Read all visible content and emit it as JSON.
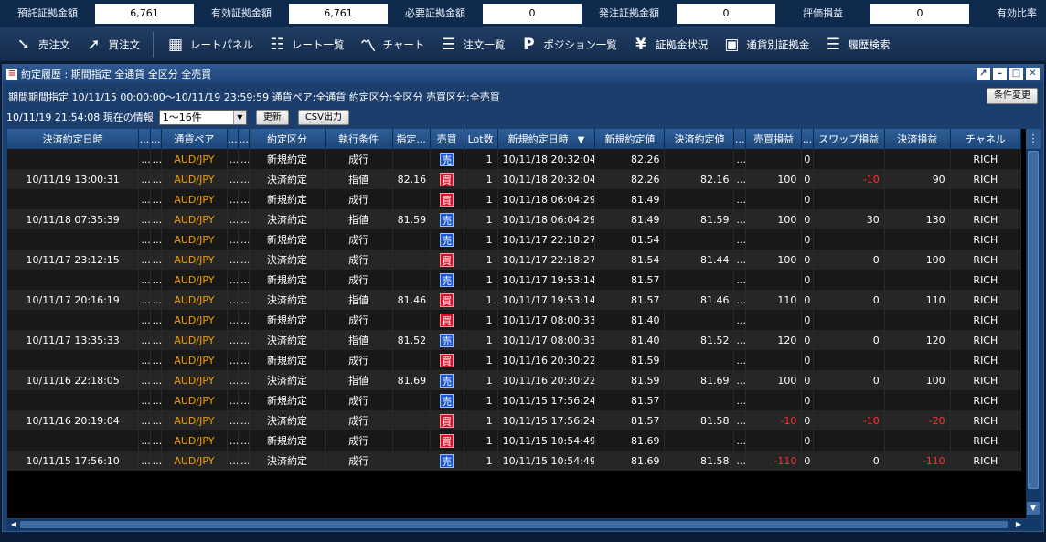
{
  "summary": [
    {
      "label": "預託証拠金額",
      "value": "6,761"
    },
    {
      "label": "有効証拠金額",
      "value": "6,761"
    },
    {
      "label": "必要証拠金額",
      "value": "0"
    },
    {
      "label": "発注証拠金額",
      "value": "0"
    },
    {
      "label": "評価損益",
      "value": "0"
    },
    {
      "label": "有効比率",
      "value": ""
    }
  ],
  "toolbar": {
    "sell_order": "売注文",
    "buy_order": "買注文",
    "rate_panel": "レートパネル",
    "rate_list": "レート一覧",
    "chart": "チャート",
    "order_list": "注文一覧",
    "position_list": "ポジション一覧",
    "margin_status": "証拠金状況",
    "currency_margin": "通貨別証拠金",
    "history_search": "履歴検索"
  },
  "panel": {
    "title": "約定履歴 : 期間指定 全通貨 全区分 全売買",
    "conditions": "期間期間指定  10/11/15 00:00:00～10/11/19 23:59:59  通貨ペア:全通貨  約定区分:全区分  売買区分:全売買",
    "change_conditions": "条件変更",
    "info": "10/11/19 21:54:08 現在の情報",
    "range_value": "1～16件",
    "refresh": "更新",
    "csv": "CSV出力"
  },
  "columns": [
    "決済約定日時",
    "...",
    "...",
    "通貨ペア",
    "...",
    "...",
    "約定区分",
    "執行条件",
    "指定...",
    "売買",
    "Lot数",
    "新規約定日時",
    "新規約定値",
    "決済約定値",
    "...",
    "売買損益",
    "...",
    "スワップ損益",
    "決済損益",
    "チャネル"
  ],
  "sort_arrow": "▼",
  "rows": [
    {
      "settle_time": "",
      "pair": "AUD/JPY",
      "kind": "新規約定",
      "exec": "成行",
      "spec": "",
      "side": "売",
      "side_type": "sell",
      "lot": "1",
      "new_time": "10/11/18 20:32:04",
      "new_price": "82.26",
      "settle_price": "",
      "pl": "",
      "pl_neg": false,
      "zero": "0",
      "swap": "",
      "swap_neg": false,
      "settle_pl": "",
      "settle_neg": false,
      "channel": "RICH"
    },
    {
      "settle_time": "10/11/19 13:00:31",
      "pair": "AUD/JPY",
      "kind": "決済約定",
      "exec": "指値",
      "spec": "82.16",
      "side": "買",
      "side_type": "buy",
      "lot": "1",
      "new_time": "10/11/18 20:32:04",
      "new_price": "82.26",
      "settle_price": "82.16",
      "pl": "100",
      "pl_neg": false,
      "zero": "0",
      "swap": "-10",
      "swap_neg": true,
      "settle_pl": "90",
      "settle_neg": false,
      "channel": "RICH"
    },
    {
      "settle_time": "",
      "pair": "AUD/JPY",
      "kind": "新規約定",
      "exec": "成行",
      "spec": "",
      "side": "買",
      "side_type": "buy",
      "lot": "1",
      "new_time": "10/11/18 06:04:29",
      "new_price": "81.49",
      "settle_price": "",
      "pl": "",
      "pl_neg": false,
      "zero": "0",
      "swap": "",
      "swap_neg": false,
      "settle_pl": "",
      "settle_neg": false,
      "channel": "RICH"
    },
    {
      "settle_time": "10/11/18 07:35:39",
      "pair": "AUD/JPY",
      "kind": "決済約定",
      "exec": "指値",
      "spec": "81.59",
      "side": "売",
      "side_type": "sell",
      "lot": "1",
      "new_time": "10/11/18 06:04:29",
      "new_price": "81.49",
      "settle_price": "81.59",
      "pl": "100",
      "pl_neg": false,
      "zero": "0",
      "swap": "30",
      "swap_neg": false,
      "settle_pl": "130",
      "settle_neg": false,
      "channel": "RICH"
    },
    {
      "settle_time": "",
      "pair": "AUD/JPY",
      "kind": "新規約定",
      "exec": "成行",
      "spec": "",
      "side": "売",
      "side_type": "sell",
      "lot": "1",
      "new_time": "10/11/17 22:18:27",
      "new_price": "81.54",
      "settle_price": "",
      "pl": "",
      "pl_neg": false,
      "zero": "0",
      "swap": "",
      "swap_neg": false,
      "settle_pl": "",
      "settle_neg": false,
      "channel": "RICH"
    },
    {
      "settle_time": "10/11/17 23:12:15",
      "pair": "AUD/JPY",
      "kind": "決済約定",
      "exec": "成行",
      "spec": "",
      "side": "買",
      "side_type": "buy",
      "lot": "1",
      "new_time": "10/11/17 22:18:27",
      "new_price": "81.54",
      "settle_price": "81.44",
      "pl": "100",
      "pl_neg": false,
      "zero": "0",
      "swap": "0",
      "swap_neg": false,
      "settle_pl": "100",
      "settle_neg": false,
      "channel": "RICH"
    },
    {
      "settle_time": "",
      "pair": "AUD/JPY",
      "kind": "新規約定",
      "exec": "成行",
      "spec": "",
      "side": "売",
      "side_type": "sell",
      "lot": "1",
      "new_time": "10/11/17 19:53:14",
      "new_price": "81.57",
      "settle_price": "",
      "pl": "",
      "pl_neg": false,
      "zero": "0",
      "swap": "",
      "swap_neg": false,
      "settle_pl": "",
      "settle_neg": false,
      "channel": "RICH"
    },
    {
      "settle_time": "10/11/17 20:16:19",
      "pair": "AUD/JPY",
      "kind": "決済約定",
      "exec": "指値",
      "spec": "81.46",
      "side": "買",
      "side_type": "buy",
      "lot": "1",
      "new_time": "10/11/17 19:53:14",
      "new_price": "81.57",
      "settle_price": "81.46",
      "pl": "110",
      "pl_neg": false,
      "zero": "0",
      "swap": "0",
      "swap_neg": false,
      "settle_pl": "110",
      "settle_neg": false,
      "channel": "RICH"
    },
    {
      "settle_time": "",
      "pair": "AUD/JPY",
      "kind": "新規約定",
      "exec": "成行",
      "spec": "",
      "side": "買",
      "side_type": "buy",
      "lot": "1",
      "new_time": "10/11/17 08:00:33",
      "new_price": "81.40",
      "settle_price": "",
      "pl": "",
      "pl_neg": false,
      "zero": "0",
      "swap": "",
      "swap_neg": false,
      "settle_pl": "",
      "settle_neg": false,
      "channel": "RICH"
    },
    {
      "settle_time": "10/11/17 13:35:33",
      "pair": "AUD/JPY",
      "kind": "決済約定",
      "exec": "指値",
      "spec": "81.52",
      "side": "売",
      "side_type": "sell",
      "lot": "1",
      "new_time": "10/11/17 08:00:33",
      "new_price": "81.40",
      "settle_price": "81.52",
      "pl": "120",
      "pl_neg": false,
      "zero": "0",
      "swap": "0",
      "swap_neg": false,
      "settle_pl": "120",
      "settle_neg": false,
      "channel": "RICH"
    },
    {
      "settle_time": "",
      "pair": "AUD/JPY",
      "kind": "新規約定",
      "exec": "成行",
      "spec": "",
      "side": "買",
      "side_type": "buy",
      "lot": "1",
      "new_time": "10/11/16 20:30:22",
      "new_price": "81.59",
      "settle_price": "",
      "pl": "",
      "pl_neg": false,
      "zero": "0",
      "swap": "",
      "swap_neg": false,
      "settle_pl": "",
      "settle_neg": false,
      "channel": "RICH"
    },
    {
      "settle_time": "10/11/16 22:18:05",
      "pair": "AUD/JPY",
      "kind": "決済約定",
      "exec": "指値",
      "spec": "81.69",
      "side": "売",
      "side_type": "sell",
      "lot": "1",
      "new_time": "10/11/16 20:30:22",
      "new_price": "81.59",
      "settle_price": "81.69",
      "pl": "100",
      "pl_neg": false,
      "zero": "0",
      "swap": "0",
      "swap_neg": false,
      "settle_pl": "100",
      "settle_neg": false,
      "channel": "RICH"
    },
    {
      "settle_time": "",
      "pair": "AUD/JPY",
      "kind": "新規約定",
      "exec": "成行",
      "spec": "",
      "side": "売",
      "side_type": "sell",
      "lot": "1",
      "new_time": "10/11/15 17:56:24",
      "new_price": "81.57",
      "settle_price": "",
      "pl": "",
      "pl_neg": false,
      "zero": "0",
      "swap": "",
      "swap_neg": false,
      "settle_pl": "",
      "settle_neg": false,
      "channel": "RICH"
    },
    {
      "settle_time": "10/11/16 20:19:04",
      "pair": "AUD/JPY",
      "kind": "決済約定",
      "exec": "成行",
      "spec": "",
      "side": "買",
      "side_type": "buy",
      "lot": "1",
      "new_time": "10/11/15 17:56:24",
      "new_price": "81.57",
      "settle_price": "81.58",
      "pl": "-10",
      "pl_neg": true,
      "zero": "0",
      "swap": "-10",
      "swap_neg": true,
      "settle_pl": "-20",
      "settle_neg": true,
      "channel": "RICH"
    },
    {
      "settle_time": "",
      "pair": "AUD/JPY",
      "kind": "新規約定",
      "exec": "成行",
      "spec": "",
      "side": "買",
      "side_type": "buy",
      "lot": "1",
      "new_time": "10/11/15 10:54:49",
      "new_price": "81.69",
      "settle_price": "",
      "pl": "",
      "pl_neg": false,
      "zero": "0",
      "swap": "",
      "swap_neg": false,
      "settle_pl": "",
      "settle_neg": false,
      "channel": "RICH"
    },
    {
      "settle_time": "10/11/15 17:56:10",
      "pair": "AUD/JPY",
      "kind": "決済約定",
      "exec": "成行",
      "spec": "",
      "side": "売",
      "side_type": "sell",
      "lot": "1",
      "new_time": "10/11/15 10:54:49",
      "new_price": "81.69",
      "settle_price": "81.58",
      "pl": "-110",
      "pl_neg": true,
      "zero": "0",
      "swap": "0",
      "swap_neg": false,
      "settle_pl": "-110",
      "settle_neg": true,
      "channel": "RICH"
    }
  ],
  "colors": {
    "sell": "#1a55d8",
    "buy": "#d8102a",
    "pair": "#f0a000",
    "negative": "#ff3030"
  }
}
